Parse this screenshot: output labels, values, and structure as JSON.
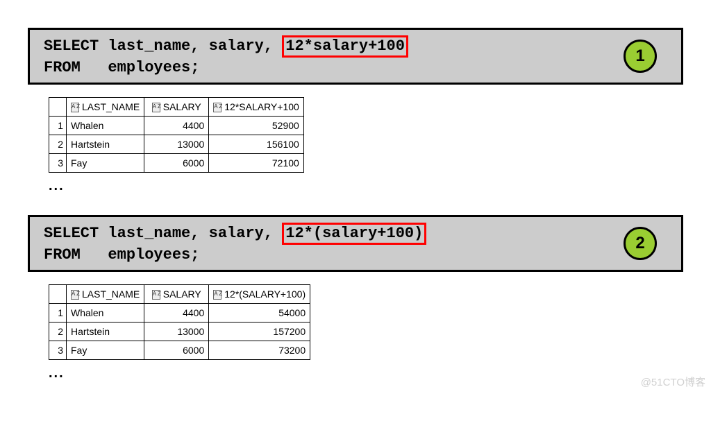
{
  "examples": [
    {
      "badge": "1",
      "line1_a": "SELECT last_name, salary, ",
      "line1_hl": "12*salary+100",
      "line2": "FROM   employees;",
      "cols": [
        "LAST_NAME",
        "SALARY",
        "12*SALARY+100"
      ],
      "rows": [
        {
          "n": "1",
          "name": "Whalen",
          "salary": "4400",
          "calc": "52900"
        },
        {
          "n": "2",
          "name": "Hartstein",
          "salary": "13000",
          "calc": "156100"
        },
        {
          "n": "3",
          "name": "Fay",
          "salary": "6000",
          "calc": "72100"
        }
      ],
      "ellipsis": "..."
    },
    {
      "badge": "2",
      "line1_a": "SELECT last_name, salary, ",
      "line1_hl": "12*(salary+100)",
      "line2": "FROM   employees;",
      "cols": [
        "LAST_NAME",
        "SALARY",
        "12*(SALARY+100)"
      ],
      "rows": [
        {
          "n": "1",
          "name": "Whalen",
          "salary": "4400",
          "calc": "54000"
        },
        {
          "n": "2",
          "name": "Hartstein",
          "salary": "13000",
          "calc": "157200"
        },
        {
          "n": "3",
          "name": "Fay",
          "salary": "6000",
          "calc": "73200"
        }
      ],
      "ellipsis": "..."
    }
  ],
  "sort_glyph": "A\nZ",
  "watermark": "@51CTO博客"
}
